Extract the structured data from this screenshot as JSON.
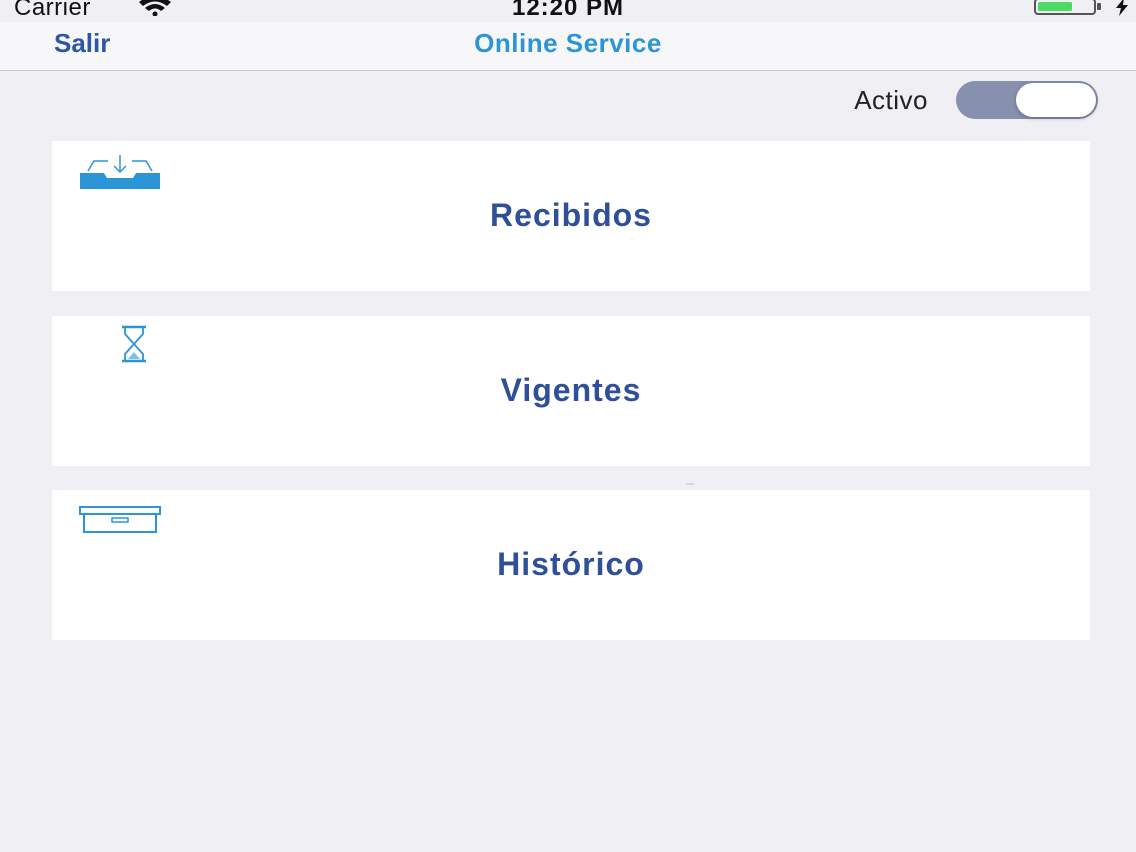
{
  "status_bar": {
    "carrier": "Carrier",
    "time": "12:20 PM",
    "icons": [
      "wifi-icon",
      "battery-icon",
      "charging-bolt-icon"
    ]
  },
  "nav": {
    "back_label": "Salir",
    "title": "Online Service"
  },
  "toggle": {
    "label": "Activo",
    "on": true
  },
  "menu": {
    "items": [
      {
        "label": "Recibidos",
        "icon": "inbox-download-icon"
      },
      {
        "label": "Vigentes",
        "icon": "hourglass-icon"
      },
      {
        "label": "Histórico",
        "icon": "archive-box-icon"
      }
    ]
  },
  "colors": {
    "background": "#efeff4",
    "nav_background": "#f7f7f9",
    "back_link": "#2f56a5",
    "title": "#2b95d6",
    "card_label": "#2f4f9a",
    "icon": "#2b95d6",
    "battery_fill": "#4cd964",
    "toggle_track": "#8890b0"
  }
}
